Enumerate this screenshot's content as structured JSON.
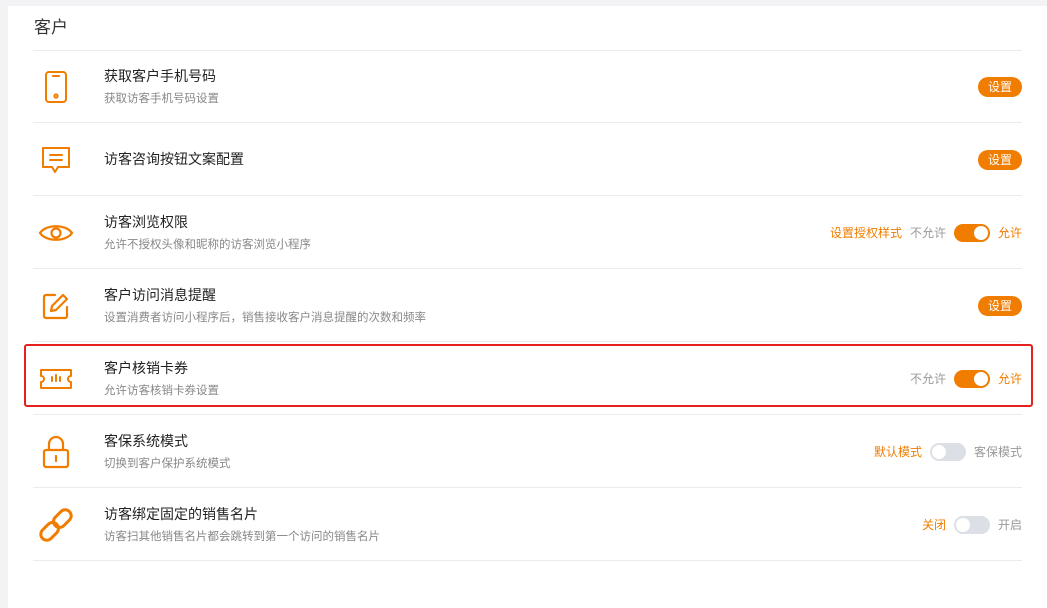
{
  "section": {
    "title": "客户"
  },
  "settings": [
    {
      "title": "获取客户手机号码",
      "desc": "获取访客手机号码设置",
      "icon": "phone-icon",
      "button": "设置"
    },
    {
      "title": "访客咨询按钮文案配置",
      "desc": "",
      "icon": "message-icon",
      "button": "设置"
    },
    {
      "title": "访客浏览权限",
      "desc": "允许不授权头像和昵称的访客浏览小程序",
      "icon": "eye-icon",
      "link": "设置授权样式",
      "off_label": "不允许",
      "on_label": "允许",
      "toggle_on": true
    },
    {
      "title": "客户访问消息提醒",
      "desc": "设置消费者访问小程序后，销售接收客户消息提醒的次数和频率",
      "icon": "edit-icon",
      "button": "设置"
    },
    {
      "title": "客户核销卡券",
      "desc": "允许访客核销卡券设置",
      "icon": "ticket-icon",
      "off_label": "不允许",
      "on_label": "允许",
      "toggle_on": true
    },
    {
      "title": "客保系统模式",
      "desc": "切换到客户保护系统模式",
      "icon": "lock-icon",
      "off_label": "默认模式",
      "on_label": "客保模式",
      "toggle_on": false
    },
    {
      "title": "访客绑定固定的销售名片",
      "desc": "访客扫其他销售名片都会跳转到第一个访问的销售名片",
      "icon": "link-icon",
      "off_label": "关闭",
      "on_label": "开启",
      "toggle_on": false
    }
  ],
  "colors": {
    "accent": "#f07c00",
    "highlight": "#e5211d",
    "toggle_off": "#dcdfe6"
  }
}
